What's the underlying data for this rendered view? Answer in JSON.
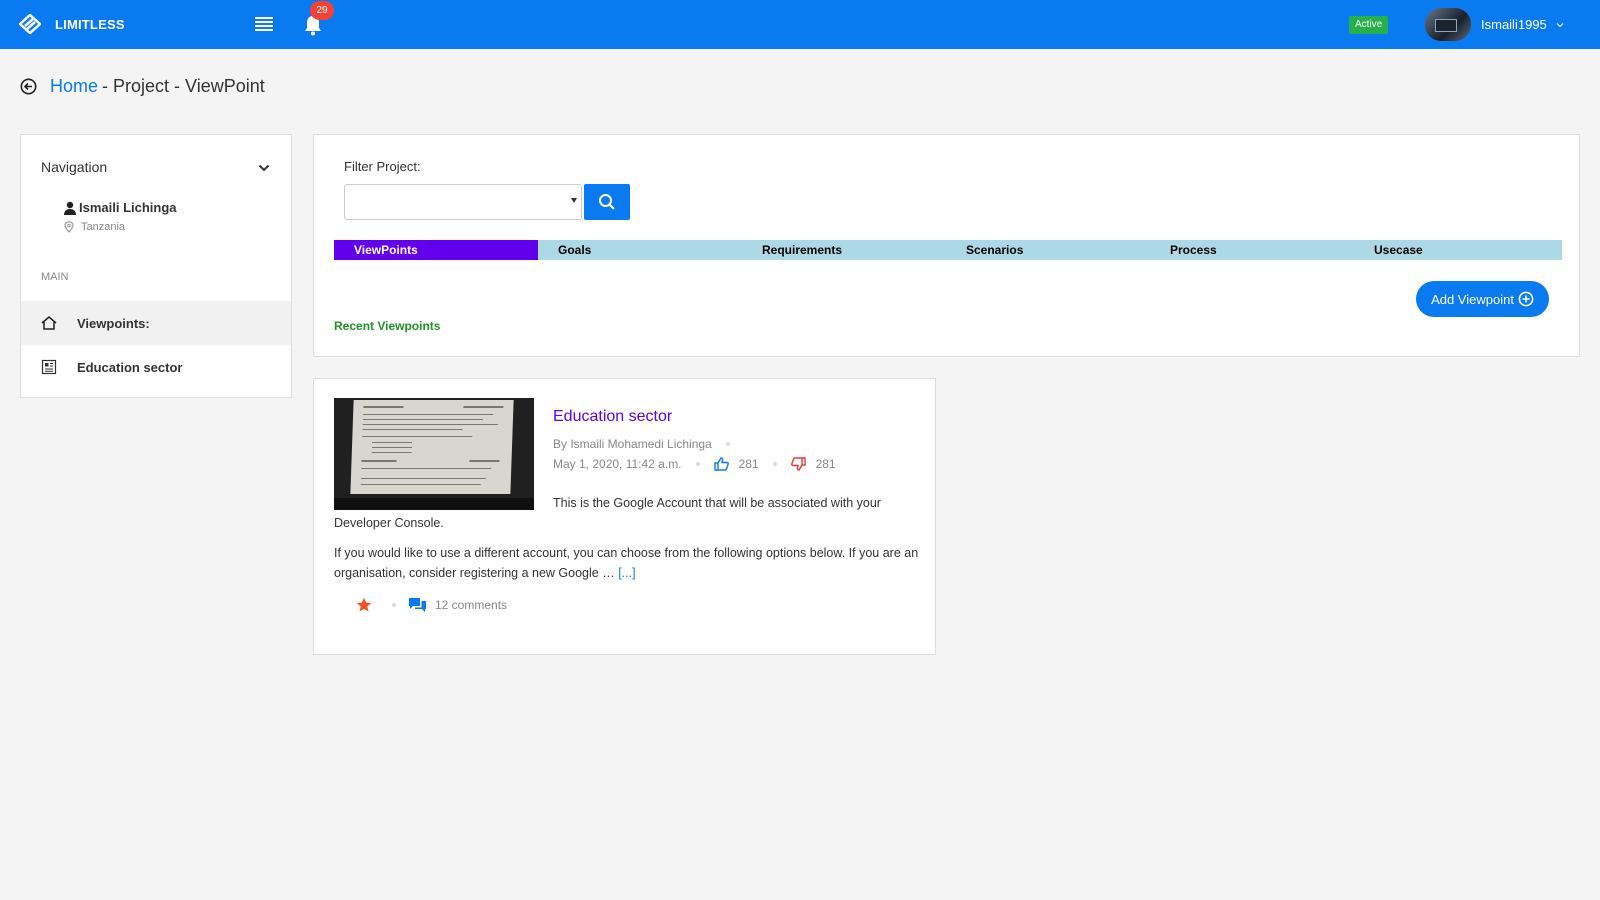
{
  "app": {
    "brand": "LIMITLESS",
    "notifications_count": "29",
    "status": "Active",
    "username": "Ismaili1995"
  },
  "breadcrumb": {
    "home": "Home",
    "rest": "- Project - ViewPoint"
  },
  "sidebar": {
    "header": "Navigation",
    "user_name": "Ismaili Lichinga",
    "location": "Tanzania",
    "section_label": "MAIN",
    "items": [
      {
        "label": "Viewpoints:",
        "icon": "home-icon",
        "active": true
      },
      {
        "label": "Education sector",
        "icon": "document-icon",
        "active": false
      }
    ]
  },
  "main": {
    "filter_label": "Filter Project:",
    "select_value": "",
    "tabs": [
      {
        "label": "ViewPoints",
        "active": true
      },
      {
        "label": "Goals"
      },
      {
        "label": "Requirements"
      },
      {
        "label": "Scenarios"
      },
      {
        "label": "Process"
      },
      {
        "label": "Usecase"
      }
    ],
    "add_button": "Add Viewpoint",
    "recent_label": "Recent Viewpoints"
  },
  "post": {
    "title": "Education sector",
    "author": "By Ismaili Mohamedi Lichinga",
    "date": "May 1, 2020, 11:42 a.m.",
    "likes": "281",
    "dislikes": "281",
    "para1": "This is the Google Account that will be associated with your Developer Console.",
    "para2": "If you would like to use a different account, you can choose from the following options below. If you are an organisation, consider registering a new Google …",
    "read_more": "[...]",
    "comments": "12 comments"
  },
  "colors": {
    "topbar": "#0a7af0",
    "tab_active": "#6200ee",
    "tabs_bg": "#add8e6",
    "recent_green": "#1e9428",
    "star": "#f4511e",
    "dislike": "#e53935"
  }
}
